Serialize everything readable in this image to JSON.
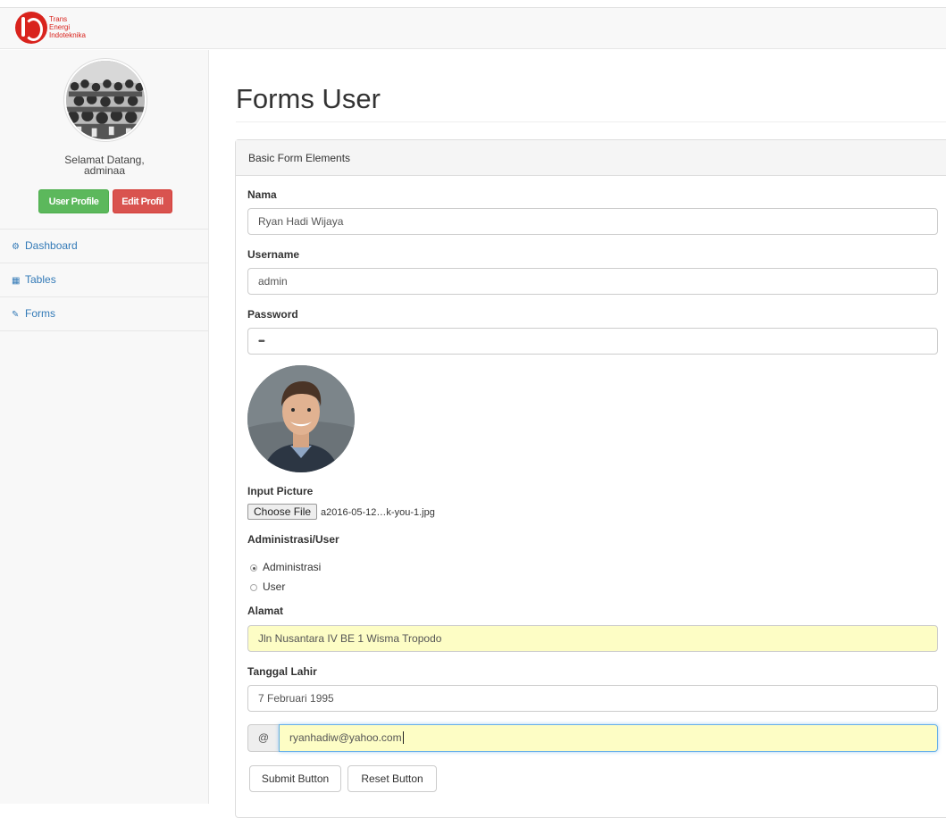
{
  "brand": {
    "line1": "Trans",
    "line2": "Energi",
    "line3": "Indoteknika"
  },
  "sidebar": {
    "welcome_line1": "Selamat Datang,",
    "welcome_line2": "adminaa",
    "user_profile_button": "User Profile",
    "edit_profile_button": "Edit Profil",
    "nav": [
      {
        "label": "Dashboard",
        "icon": "dashboard-icon"
      },
      {
        "label": "Tables",
        "icon": "table-icon"
      },
      {
        "label": "Forms",
        "icon": "edit-icon"
      }
    ]
  },
  "page": {
    "title": "Forms User"
  },
  "panel": {
    "heading": "Basic Form Elements"
  },
  "form": {
    "nama_label": "Nama",
    "nama_value": "Ryan Hadi Wijaya",
    "username_label": "Username",
    "username_value": "admin",
    "password_label": "Password",
    "password_value": "•••••",
    "picture_label": "Input Picture",
    "choose_file_label": "Choose File",
    "file_name": "a2016-05-12…k-you-1.jpg",
    "role_label": "Administrasi/User",
    "role_options": [
      "Administrasi",
      "User"
    ],
    "role_selected": "Administrasi",
    "alamat_label": "Alamat",
    "alamat_value": "Jln Nusantara IV BE 1 Wisma Tropodo",
    "tanggal_label": "Tanggal Lahir",
    "tanggal_value": "7 Februari 1995",
    "email_addon": "@",
    "email_value": "ryanhadiw@yahoo.com",
    "submit_label": "Submit Button",
    "reset_label": "Reset Button"
  },
  "colors": {
    "brand_red": "#d9231d",
    "link_blue": "#337ab7",
    "button_green": "#5cb85c",
    "button_red": "#d9534f",
    "autofill_yellow": "#fdfdc5"
  }
}
